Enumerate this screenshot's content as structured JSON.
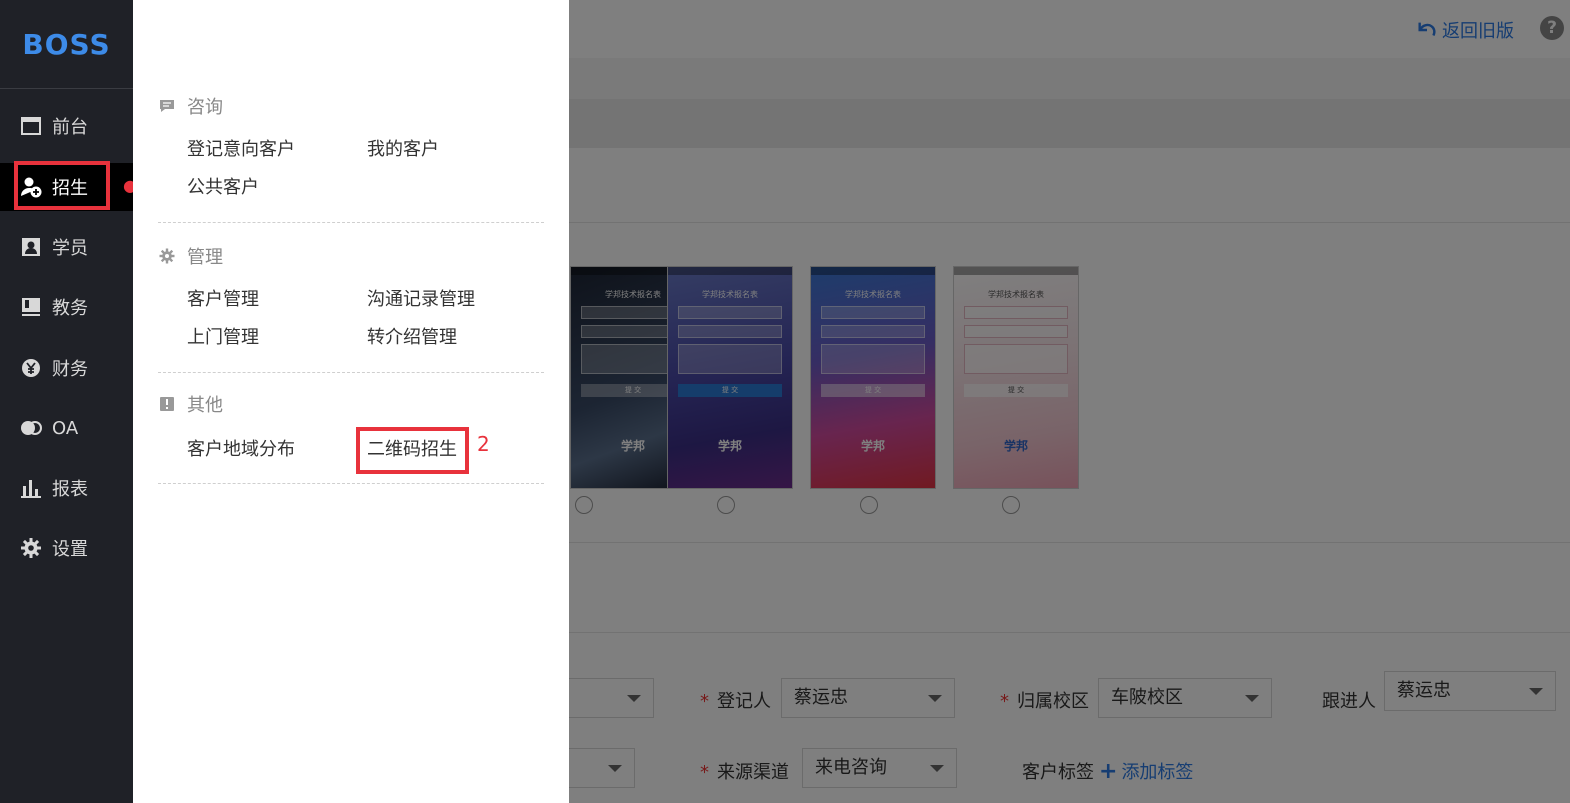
{
  "colors": {
    "accent": "#2d7be5",
    "sidebar_bg": "#1f2127",
    "highlight": "#e8323c"
  },
  "sidebar": {
    "logo": "BOSS",
    "items": [
      {
        "label": "前台",
        "icon": "calendar-window-icon"
      },
      {
        "label": "招生",
        "icon": "user-add-icon",
        "active": true
      },
      {
        "label": "学员",
        "icon": "id-card-icon"
      },
      {
        "label": "教务",
        "icon": "book-icon"
      },
      {
        "label": "财务",
        "icon": "yen-coin-icon"
      },
      {
        "label": "OA",
        "icon": "toggle-icon"
      },
      {
        "label": "报表",
        "icon": "bar-chart-icon"
      },
      {
        "label": "设置",
        "icon": "gear-icon"
      }
    ]
  },
  "menu": {
    "sections": [
      {
        "title": "咨询",
        "icon": "chat-icon",
        "links": [
          "登记意向客户",
          "我的客户",
          "公共客户"
        ]
      },
      {
        "title": "管理",
        "icon": "gear-icon",
        "links": [
          "客户管理",
          "沟通记录管理",
          "上门管理",
          "转介绍管理"
        ]
      },
      {
        "title": "其他",
        "icon": "info-icon",
        "links": [
          "客户地域分布",
          "二维码招生"
        ]
      }
    ],
    "step_marker": "2"
  },
  "header": {
    "return_old": "返回旧版",
    "help_icon": "?"
  },
  "templates": {
    "title": "学邦技术报名表",
    "submit": "提 交",
    "logo": "学邦"
  },
  "form": {
    "registrar_label": "登记人",
    "registrar_value": "蔡运忠",
    "campus_label": "归属校区",
    "campus_value": "车陂校区",
    "follower_label": "跟进人",
    "follower_value": "蔡运忠",
    "source_label": "来源渠道",
    "source_value": "来电咨询",
    "tags_label": "客户标签",
    "add_tag": "添加标签",
    "required_mark": "*"
  }
}
